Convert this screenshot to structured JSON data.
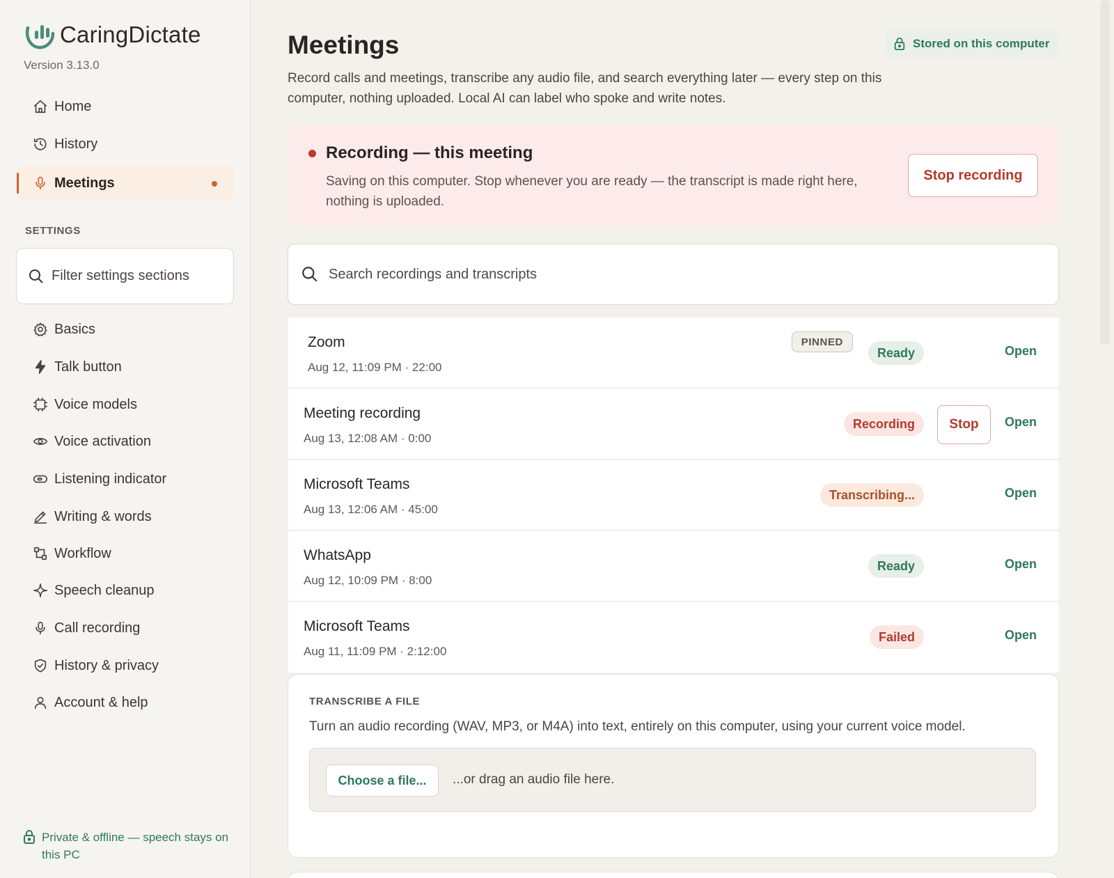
{
  "app": {
    "name": "CaringDictate",
    "version": "Version 3.13.0"
  },
  "sidebar": {
    "nav": [
      {
        "label": "Home",
        "icon": "home-icon"
      },
      {
        "label": "History",
        "icon": "history-icon"
      },
      {
        "label": "Meetings",
        "icon": "microphone-icon",
        "active": true
      }
    ],
    "settings_heading": "SETTINGS",
    "filter_placeholder": "Filter settings sections",
    "settings_items": [
      {
        "label": "Basics",
        "icon": "gear-icon"
      },
      {
        "label": "Talk button",
        "icon": "lightning-icon"
      },
      {
        "label": "Voice models",
        "icon": "chip-icon"
      },
      {
        "label": "Voice activation",
        "icon": "eye-icon"
      },
      {
        "label": "Listening indicator",
        "icon": "toggle-icon"
      },
      {
        "label": "Writing & words",
        "icon": "pencil-icon"
      },
      {
        "label": "Workflow",
        "icon": "workflow-icon"
      },
      {
        "label": "Speech cleanup",
        "icon": "sparkle-icon"
      },
      {
        "label": "Call recording",
        "icon": "microphone-icon"
      },
      {
        "label": "History & privacy",
        "icon": "shield-icon"
      },
      {
        "label": "Account & help",
        "icon": "user-icon"
      }
    ],
    "privacy_note": "Private & offline — speech stays on this PC"
  },
  "main": {
    "title": "Meetings",
    "stored_badge": "Stored on this computer",
    "subtitle": "Record calls and meetings, transcribe any audio file, and search everything later — every step on this computer, nothing uploaded. Local AI can label who spoke and write notes.",
    "recording_banner": {
      "title": "Recording — this meeting",
      "description": "Saving on this computer. Stop whenever you are ready — the transcript is made right here, nothing is uploaded.",
      "stop_button": "Stop recording"
    },
    "search_placeholder": "Search recordings and transcripts",
    "recordings": [
      {
        "title": "Zoom",
        "meta": "Aug 12, 11:09 PM · 22:00",
        "status": "Ready",
        "status_type": "ready",
        "pinned": "PINNED",
        "open": "Open"
      },
      {
        "title": "Meeting recording",
        "meta": "Aug 13, 12:08 AM · 0:00",
        "status": "Recording",
        "status_type": "recording",
        "stop": "Stop",
        "open": "Open"
      },
      {
        "title": "Microsoft Teams",
        "meta": "Aug 13, 12:06 AM · 45:00",
        "status": "Transcribing...",
        "status_type": "transcribing",
        "open": "Open"
      },
      {
        "title": "WhatsApp",
        "meta": "Aug 12, 10:09 PM · 8:00",
        "status": "Ready",
        "status_type": "ready",
        "open": "Open"
      },
      {
        "title": "Microsoft Teams",
        "meta": "Aug 11, 11:09 PM · 2:12:00",
        "status": "Failed",
        "status_type": "failed",
        "open": "Open"
      }
    ],
    "transcribe_file": {
      "heading": "TRANSCRIBE A FILE",
      "description": "Turn an audio recording (WAV, MP3, or M4A) into text, entirely on this computer, using your current voice model.",
      "choose_button": "Choose a file...",
      "drag_text": "...or drag an audio file here."
    }
  },
  "colors": {
    "accent": "#c9652f",
    "green": "#2f7a57",
    "red": "#b43a2c",
    "background": "#f3f1ec"
  }
}
